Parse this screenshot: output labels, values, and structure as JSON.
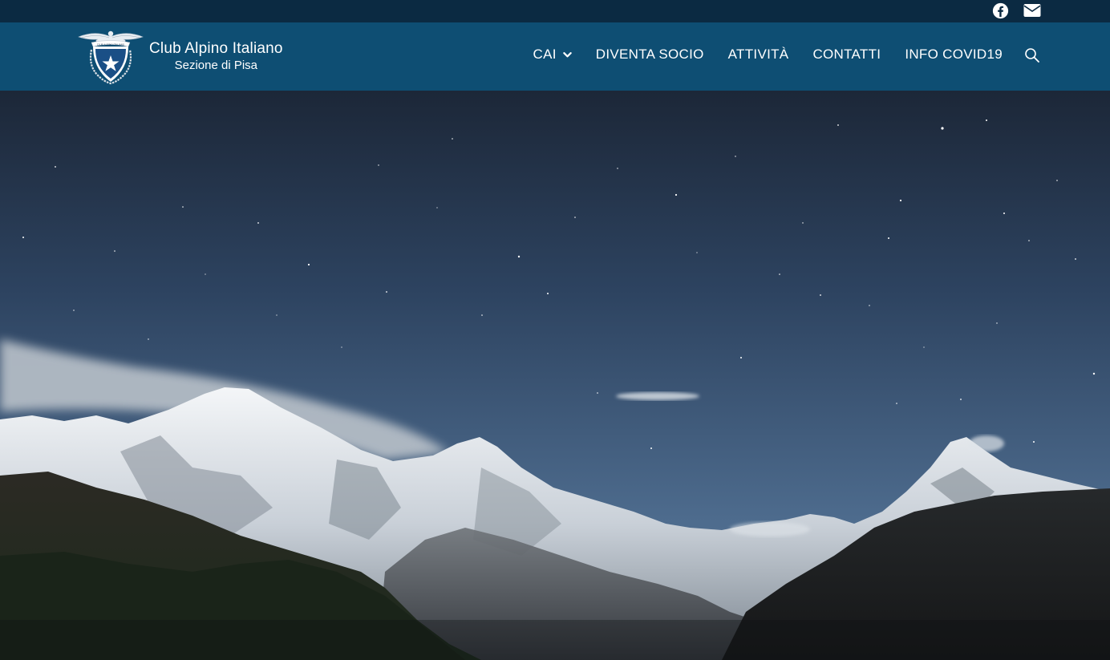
{
  "topbar": {
    "social": [
      {
        "icon": "facebook-icon",
        "label": "Facebook"
      },
      {
        "icon": "envelope-icon",
        "label": "Email"
      }
    ]
  },
  "header": {
    "logo": {
      "line1": "Club Alpino Italiano",
      "line2": "Sezione di Pisa",
      "emblem_text": "CLUB ALPINO ITALIANO"
    },
    "nav": {
      "cai": "CAI",
      "diventa_socio": "DIVENTA SOCIO",
      "attivita": "ATTIVITÀ",
      "contatti": "CONTATTI",
      "info_covid": "INFO COVID19"
    },
    "search_icon": "search-icon"
  },
  "colors": {
    "topbar": "#0b2a42",
    "header": "#0e4e73",
    "sky_top": "#1d2a3f",
    "sky_bottom": "#5b7a9c"
  }
}
